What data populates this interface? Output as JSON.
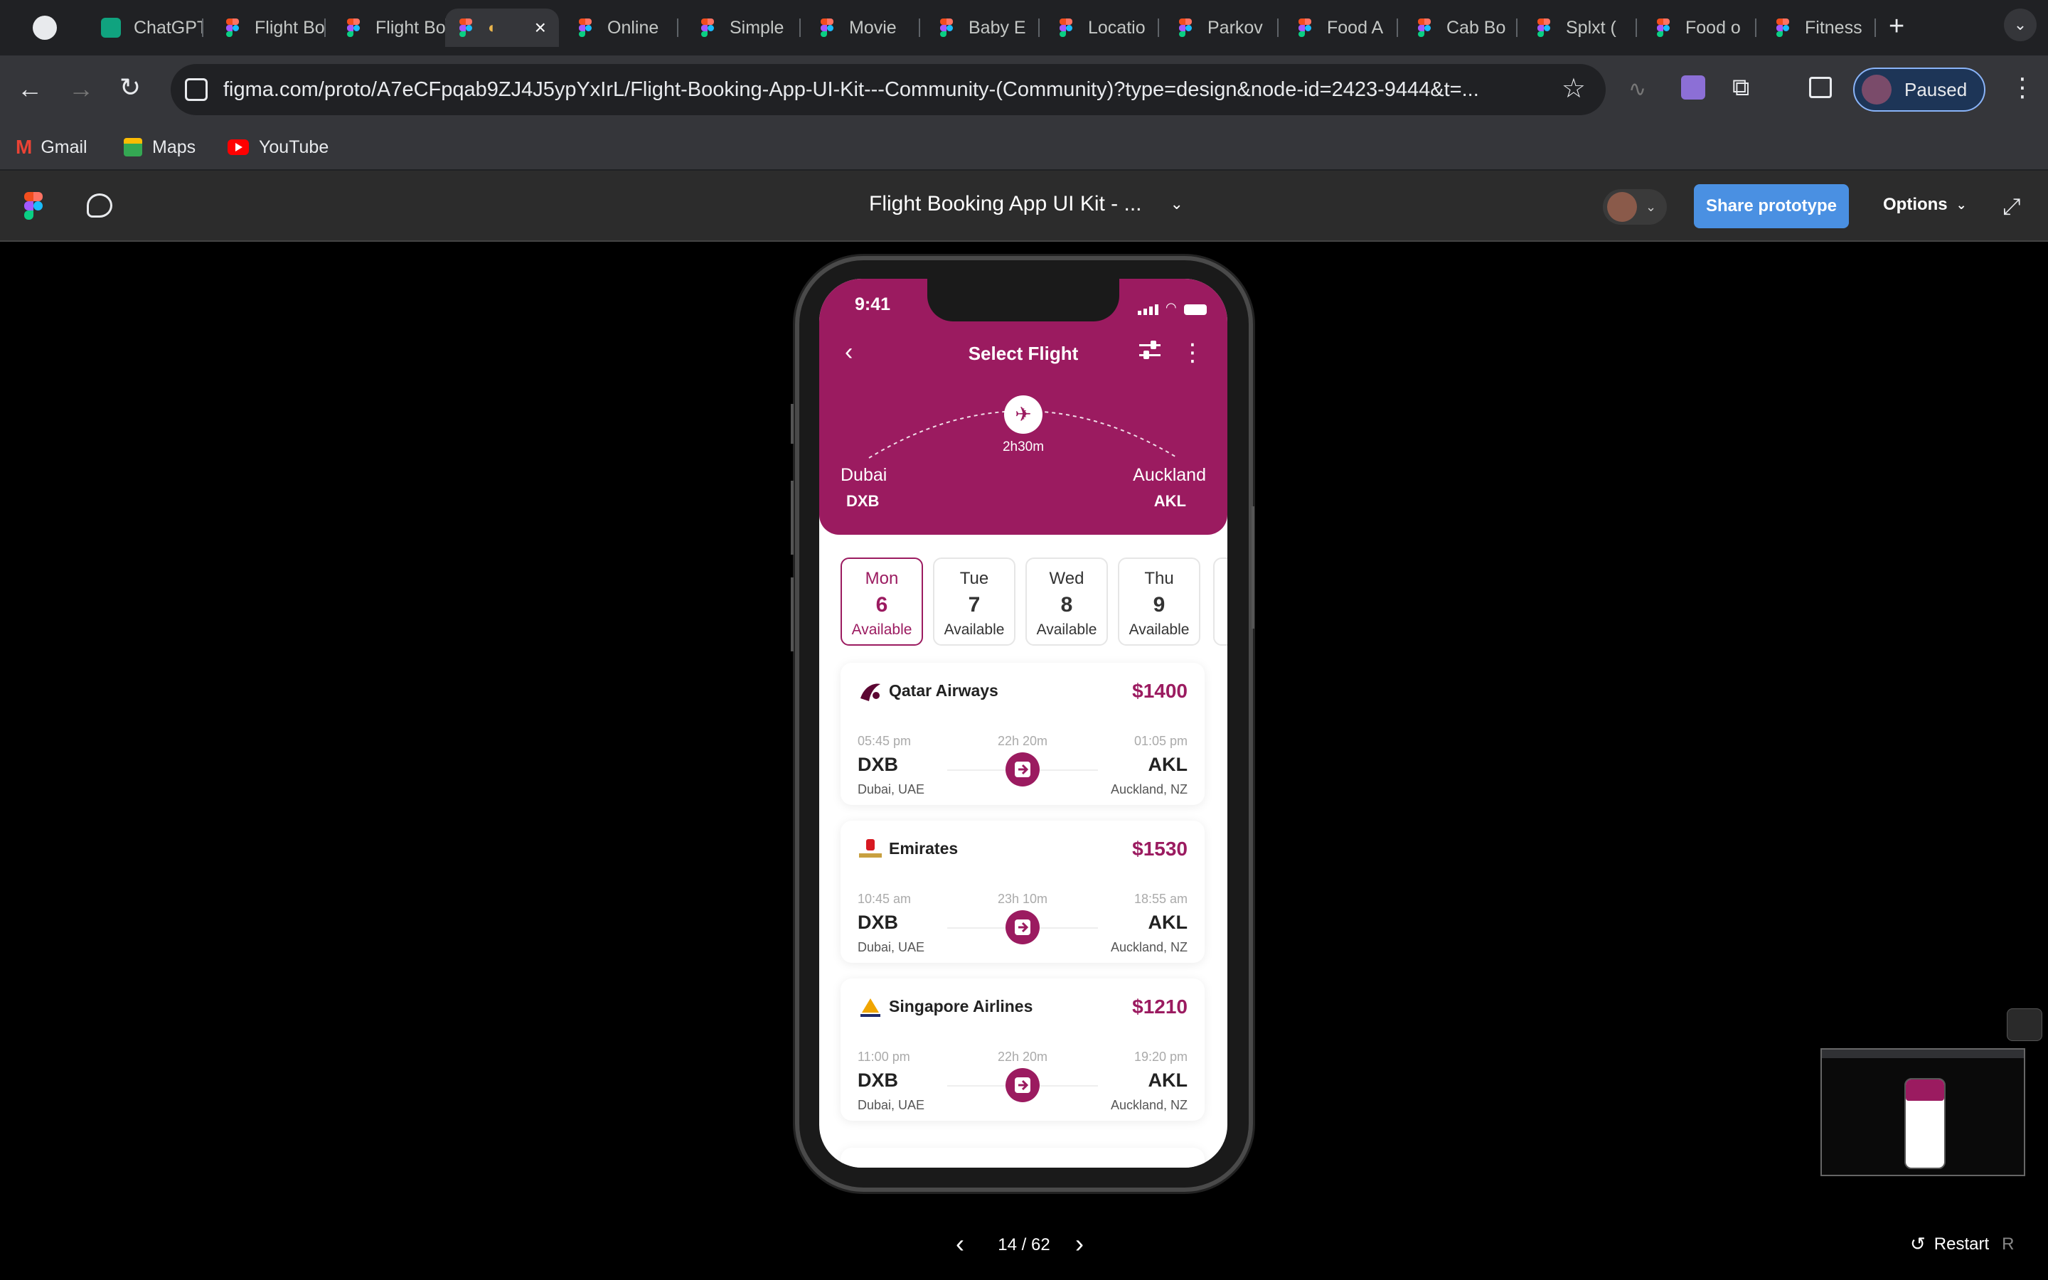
{
  "browser": {
    "tabs": [
      {
        "label": "ChatGPT",
        "icon": "chatgpt-icon"
      },
      {
        "label": "Flight Booking",
        "icon": "figma-icon"
      },
      {
        "label": "Flight Booking",
        "icon": "figma-icon"
      },
      {
        "label": "",
        "icon": "figma-icon"
      },
      {
        "label": "Online",
        "icon": "figma-icon"
      },
      {
        "label": "Simple",
        "icon": "figma-icon"
      },
      {
        "label": "Movie",
        "icon": "figma-icon"
      },
      {
        "label": "Baby E",
        "icon": "figma-icon"
      },
      {
        "label": "Locatio",
        "icon": "figma-icon"
      },
      {
        "label": "Parkov",
        "icon": "figma-icon"
      },
      {
        "label": "Food A",
        "icon": "figma-icon"
      },
      {
        "label": "Cab Bo",
        "icon": "figma-icon"
      },
      {
        "label": "Splxt (",
        "icon": "figma-icon"
      },
      {
        "label": "Food o",
        "icon": "figma-icon"
      },
      {
        "label": "Fitness",
        "icon": "figma-icon"
      }
    ],
    "url": "figma.com/proto/A7eCFpqab9ZJ4J5ypYxIrL/Flight-Booking-App-UI-Kit---Community-(Community)?type=design&node-id=2423-9444&t=...",
    "profile_label": "Paused",
    "bookmarks": [
      {
        "label": "Gmail",
        "icon": "gmail-icon"
      },
      {
        "label": "Maps",
        "icon": "maps-icon"
      },
      {
        "label": "YouTube",
        "icon": "youtube-icon"
      }
    ]
  },
  "figma": {
    "file_title": "Flight Booking App UI Kit - ...",
    "share_label": "Share prototype",
    "options_label": "Options",
    "page_counter": "14 / 62",
    "restart_label": "Restart",
    "restart_shortcut": "R"
  },
  "app": {
    "status_time": "9:41",
    "header_title": "Select Flight",
    "route": {
      "from_city": "Dubai",
      "from_code": "DXB",
      "to_city": "Auckland",
      "to_code": "AKL",
      "duration": "2h30m"
    },
    "days": [
      {
        "name": "Mon",
        "date": "6",
        "status": "Available",
        "selected": true
      },
      {
        "name": "Tue",
        "date": "7",
        "status": "Available",
        "selected": false
      },
      {
        "name": "Wed",
        "date": "8",
        "status": "Available",
        "selected": false
      },
      {
        "name": "Thu",
        "date": "9",
        "status": "Available",
        "selected": false
      }
    ],
    "flights": [
      {
        "airline": "Qatar Airways",
        "price": "$1400",
        "dep_time": "05:45 pm",
        "arr_time": "01:05 pm",
        "duration": "22h 20m",
        "from_code": "DXB",
        "to_code": "AKL",
        "from_place": "Dubai, UAE",
        "to_place": "Auckland, NZ"
      },
      {
        "airline": "Emirates",
        "price": "$1530",
        "dep_time": "10:45 am",
        "arr_time": "18:55 am",
        "duration": "23h 10m",
        "from_code": "DXB",
        "to_code": "AKL",
        "from_place": "Dubai, UAE",
        "to_place": "Auckland, NZ"
      },
      {
        "airline": "Singapore Airlines",
        "price": "$1210",
        "dep_time": "11:00 pm",
        "arr_time": "19:20 pm",
        "duration": "22h 20m",
        "from_code": "DXB",
        "to_code": "AKL",
        "from_place": "Dubai, UAE",
        "to_place": "Auckland, NZ"
      }
    ]
  },
  "colors": {
    "brand": "#9b1b60",
    "share_button": "#4a90e2"
  }
}
